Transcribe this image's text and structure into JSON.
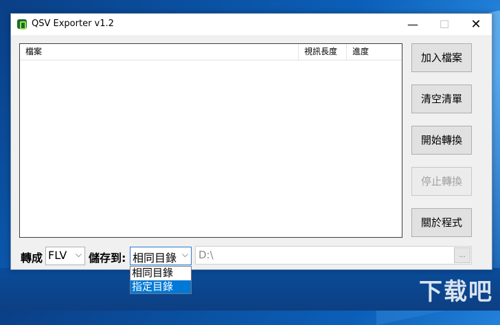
{
  "window": {
    "title": "QSV Exporter v1.2"
  },
  "titlebar_buttons": {
    "minimize": "—",
    "maximize": "☐",
    "close": "✕"
  },
  "list": {
    "columns": [
      "檔案",
      "視訊長度",
      "進度"
    ],
    "rows": []
  },
  "side_buttons": {
    "add_files": "加入檔案",
    "clear_list": "清空清單",
    "start_convert": "開始轉換",
    "stop_convert": "停止轉換",
    "about": "關於程式"
  },
  "bottom": {
    "convert_label": "轉成",
    "format_value": "FLV",
    "save_label": "儲存到:",
    "save_value": "相同目錄",
    "path_value": "D:\\",
    "browse_label": "..."
  },
  "save_dropdown": {
    "options": [
      "相同目錄",
      "指定目錄"
    ],
    "highlighted": "指定目錄"
  },
  "watermark": "下载吧",
  "colors": {
    "accent": "#0078d7",
    "app_icon": "#1e6b28"
  }
}
